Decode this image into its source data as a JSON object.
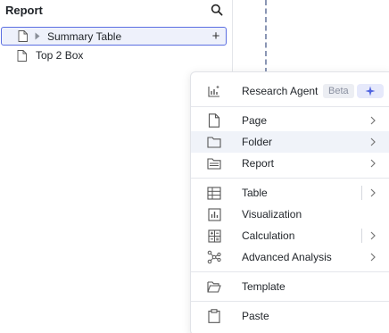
{
  "panel": {
    "title": "Report",
    "items": [
      {
        "label": "Summary Table",
        "selected": true
      },
      {
        "label": "Top 2 Box",
        "selected": false
      }
    ]
  },
  "menu": {
    "research": {
      "label": "Research Agent",
      "badge": "Beta"
    },
    "items": [
      {
        "label": "Page"
      },
      {
        "label": "Folder"
      },
      {
        "label": "Report"
      },
      {
        "label": "Table"
      },
      {
        "label": "Visualization"
      },
      {
        "label": "Calculation"
      },
      {
        "label": "Advanced Analysis"
      },
      {
        "label": "Template"
      },
      {
        "label": "Paste"
      }
    ]
  },
  "colors": {
    "accent": "#5b6ee1",
    "hover": "#f0f3f9",
    "badge_bg": "#eceef3",
    "spark": "#5b6ee1"
  }
}
